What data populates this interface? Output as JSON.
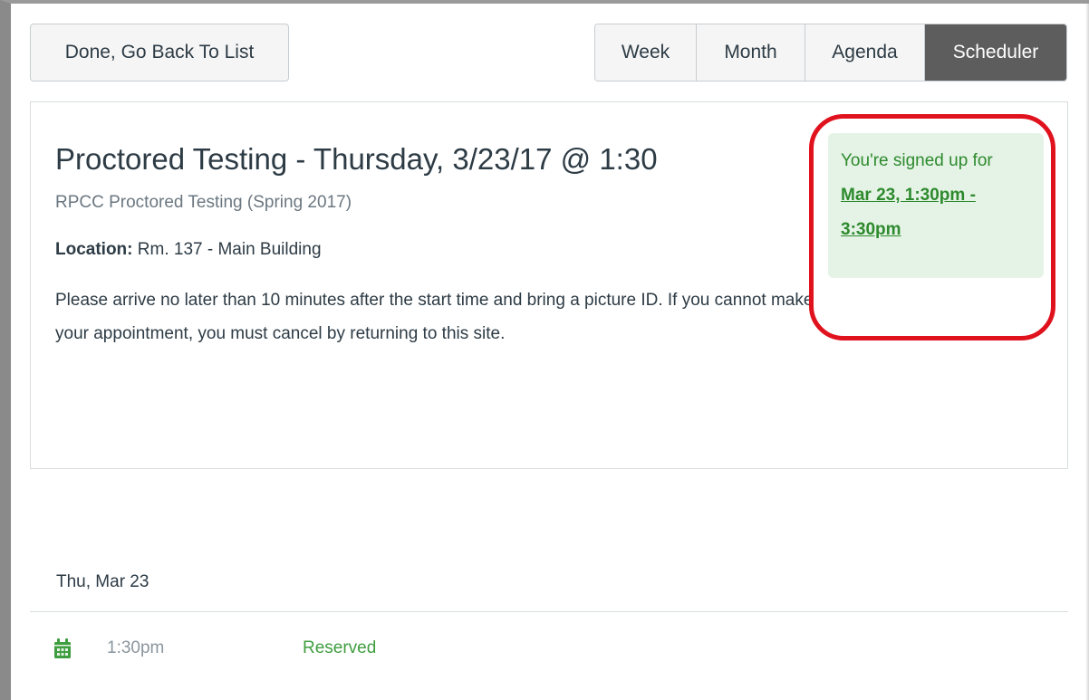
{
  "toolbar": {
    "done_label": "Done, Go Back To List",
    "view_tabs": [
      {
        "label": "Week",
        "active": false
      },
      {
        "label": "Month",
        "active": false
      },
      {
        "label": "Agenda",
        "active": false
      },
      {
        "label": "Scheduler",
        "active": true
      }
    ]
  },
  "event": {
    "title": "Proctored Testing - Thursday, 3/23/17 @ 1:30",
    "calendar_name": "RPCC Proctored Testing (Spring 2017)",
    "location_label": "Location:",
    "location_value": "Rm. 137 - Main Building",
    "description": "Please arrive no later than 10 minutes after the start time and bring a picture ID. If you cannot make your appointment, you must cancel by returning to this site."
  },
  "signup": {
    "message": "You're signed up for",
    "link_text": "Mar 23, 1:30pm - 3:30pm"
  },
  "schedule": {
    "date_heading": "Thu, Mar 23",
    "slots": [
      {
        "time": "1:30pm",
        "status": "Reserved",
        "icon": "calendar-icon"
      }
    ]
  },
  "colors": {
    "active_tab": "#5d5d5d",
    "success_text": "#2d8a2d",
    "success_bg": "#e5f3e6",
    "highlight_ring": "#e0121d"
  }
}
